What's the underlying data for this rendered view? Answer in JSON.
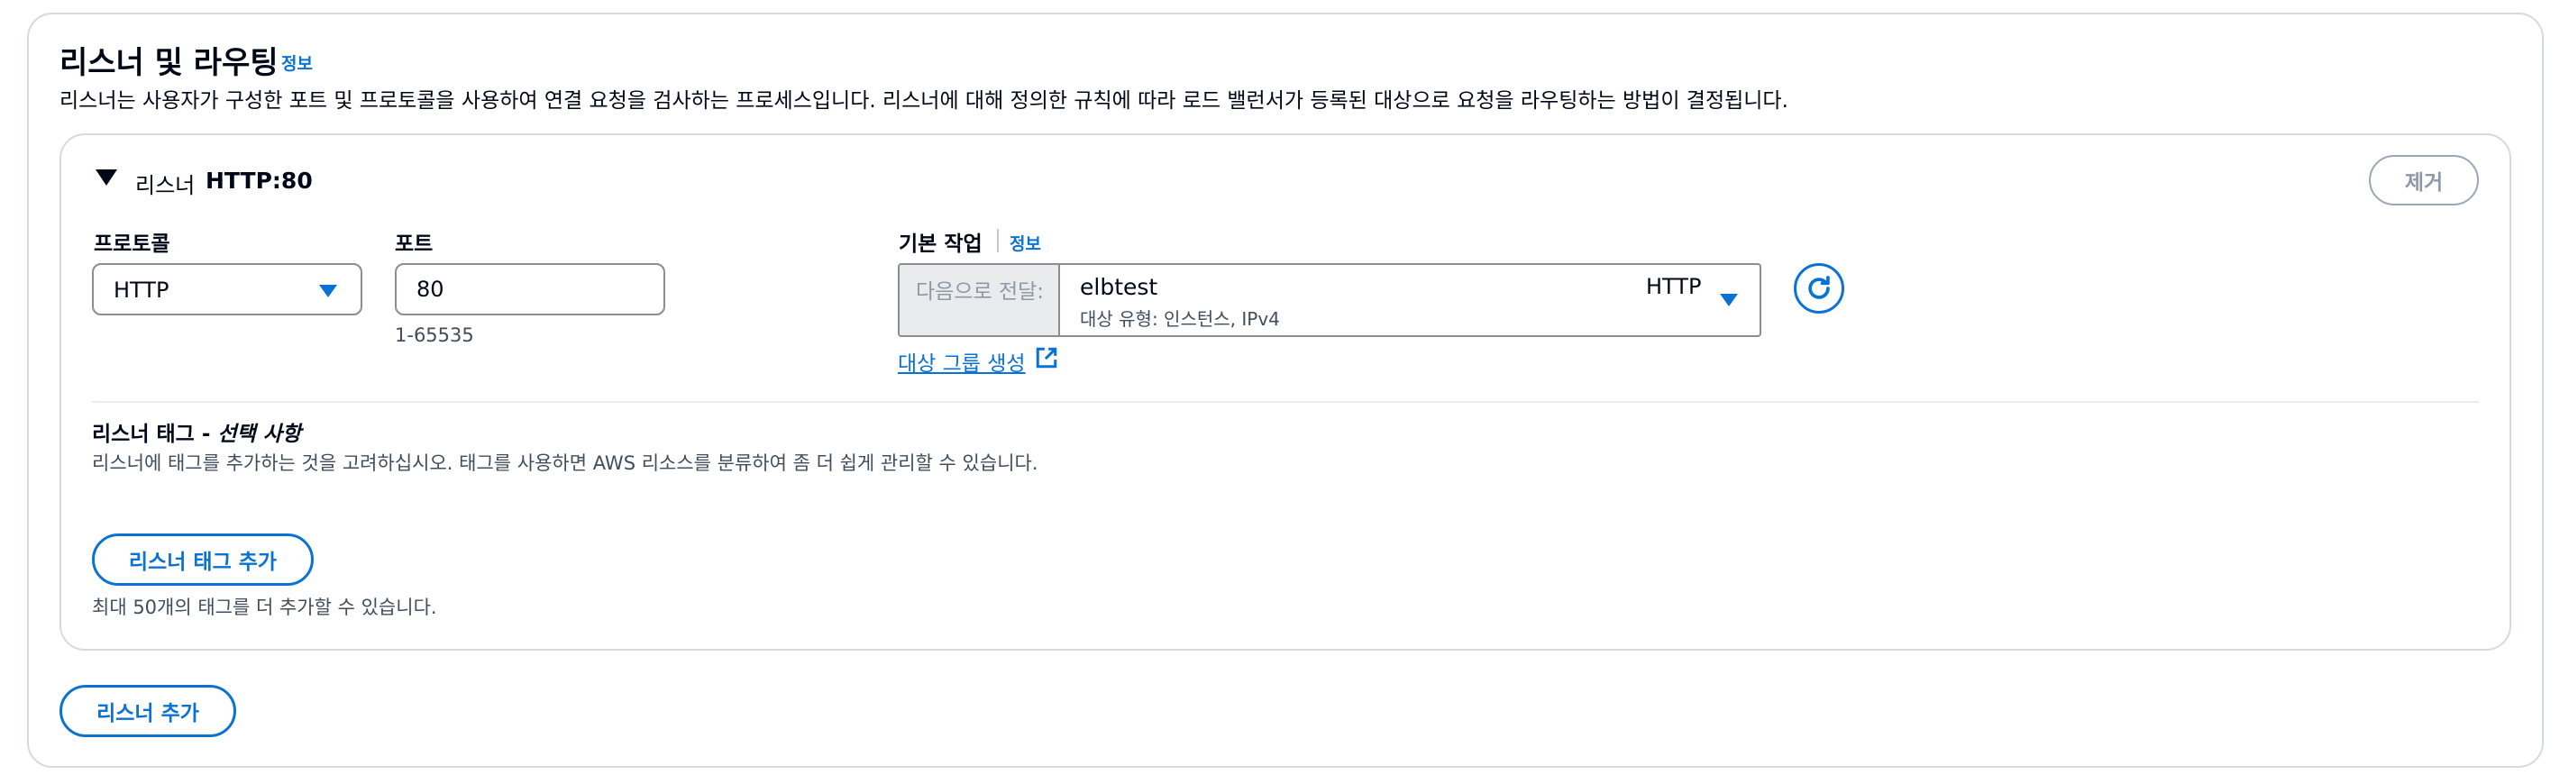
{
  "section": {
    "title": "리스너 및 라우팅",
    "info_label": "정보",
    "description": "리스너는 사용자가 구성한 포트 및 프로토콜을 사용하여 연결 요청을 검사하는 프로세스입니다. 리스너에 대해 정의한 규칙에 따라 로드 밸런서가 등록된 대상으로 요청을 라우팅하는 방법이 결정됩니다."
  },
  "listener": {
    "header_label": "리스너",
    "header_value": "HTTP:80",
    "remove_label": "제거",
    "protocol": {
      "label": "프로토콜",
      "value": "HTTP"
    },
    "port": {
      "label": "포트",
      "value": "80",
      "hint": "1-65535"
    },
    "default_action": {
      "label": "기본 작업",
      "info_label": "정보",
      "forward_prefix": "다음으로 전달:",
      "target_group_name": "elbtest",
      "target_group_desc": "대상 유형: 인스턴스, IPv4",
      "target_group_protocol": "HTTP",
      "create_link": "대상 그룹 생성"
    },
    "tags": {
      "title": "리스너 태그 - ",
      "title_optional": "선택 사항",
      "description": "리스너에 태그를 추가하는 것을 고려하십시오. 태그를 사용하면 AWS 리소스를 분류하여 좀 더 쉽게 관리할 수 있습니다.",
      "add_button": "리스너 태그 추가",
      "limit_text": "최대 50개의 태그를 더 추가할 수 있습니다."
    }
  },
  "add_listener_button": "리스너 추가",
  "colors": {
    "accent": "#0972d3",
    "text": "#000716",
    "muted": "#414d5c",
    "border": "#d5dbdb"
  }
}
